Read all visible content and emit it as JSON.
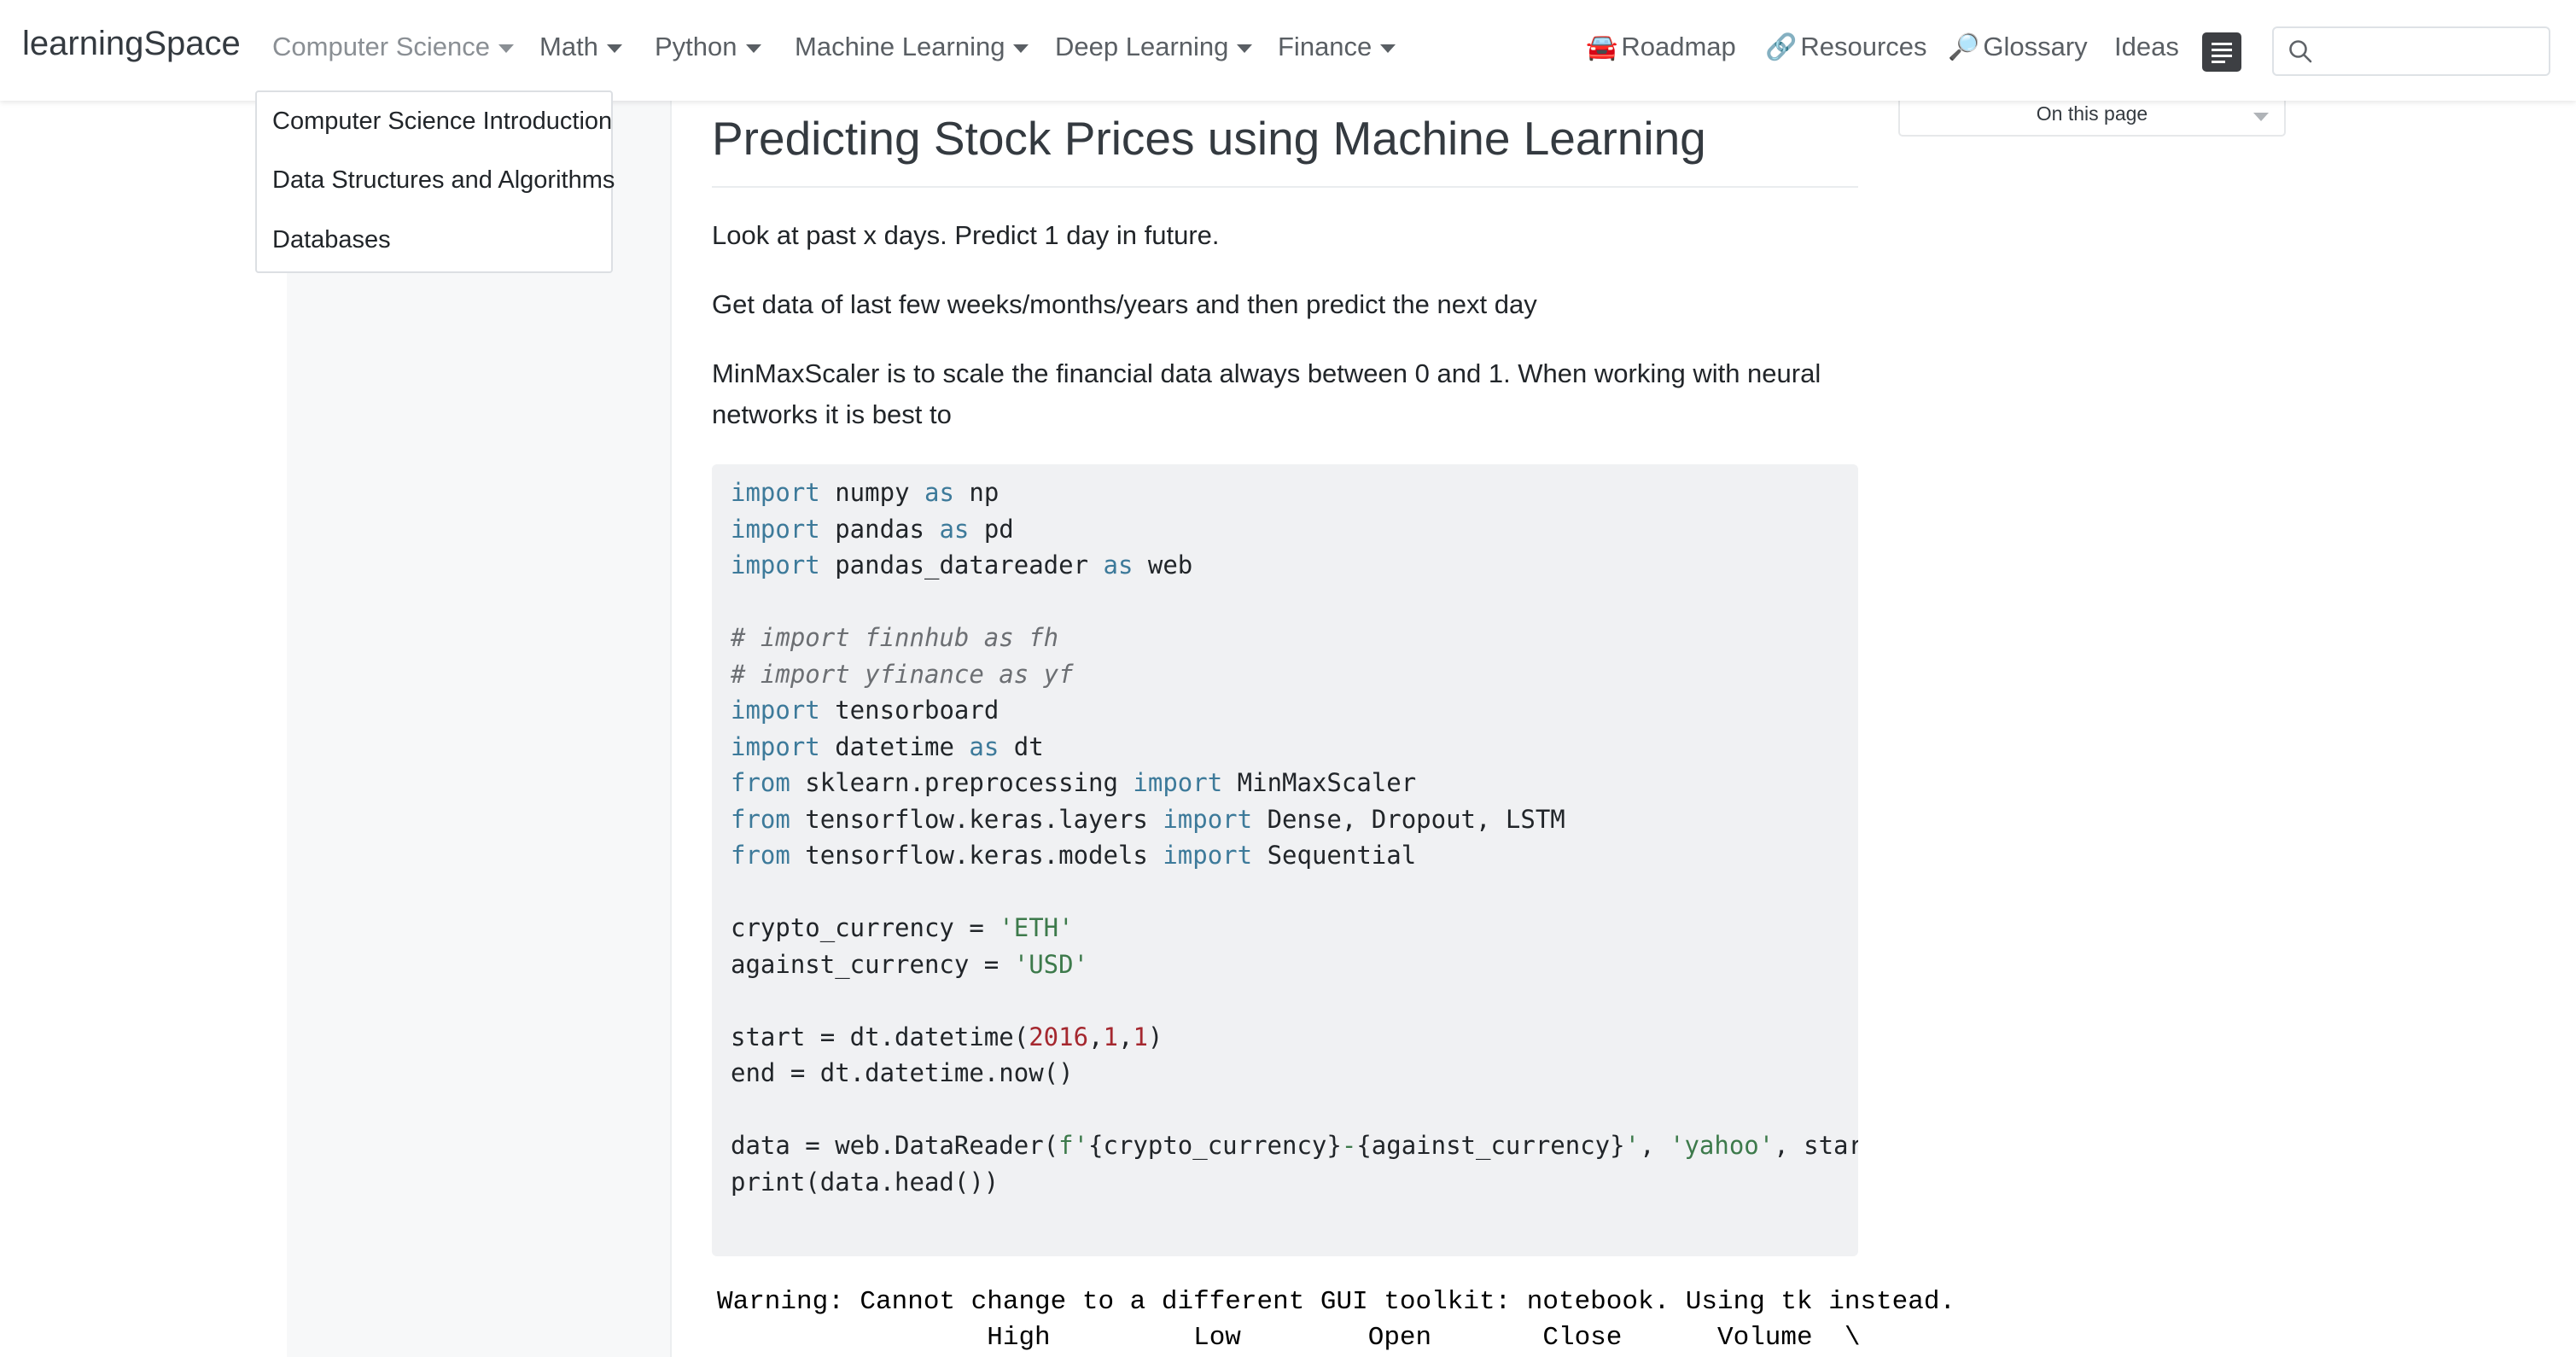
{
  "navbar": {
    "brand": "learningSpace",
    "menus": [
      "Computer Science",
      "Math",
      "Python",
      "Machine Learning",
      "Deep Learning",
      "Finance"
    ],
    "links": [
      {
        "icon": "🚘",
        "label": "Roadmap"
      },
      {
        "icon": "🔗",
        "label": "Resources"
      },
      {
        "icon": "🔎",
        "label": "Glossary"
      },
      {
        "icon": "",
        "label": "Ideas"
      }
    ],
    "search_placeholder": ""
  },
  "dropdown": {
    "items": [
      "Computer Science Introduction",
      "Data Structures and Algorithms",
      "Databases"
    ]
  },
  "toc": {
    "label": "On this page"
  },
  "article": {
    "title": "Predicting Stock Prices using Machine Learning",
    "paragraphs": [
      "Look at past x days. Predict 1 day in future.",
      "Get data of last few weeks/months/years and then predict the next day",
      "MinMaxScaler is to scale the financial data always between 0 and 1. When working with neural networks it is best to"
    ],
    "code_lines": [
      [
        {
          "t": "import",
          "c": "kw"
        },
        {
          "t": " numpy ",
          "c": ""
        },
        {
          "t": "as",
          "c": "kw"
        },
        {
          "t": " np",
          "c": ""
        }
      ],
      [
        {
          "t": "import",
          "c": "kw"
        },
        {
          "t": " pandas ",
          "c": ""
        },
        {
          "t": "as",
          "c": "kw"
        },
        {
          "t": " pd",
          "c": ""
        }
      ],
      [
        {
          "t": "import",
          "c": "kw"
        },
        {
          "t": " pandas_datareader ",
          "c": ""
        },
        {
          "t": "as",
          "c": "kw"
        },
        {
          "t": " web",
          "c": ""
        }
      ],
      [],
      [
        {
          "t": "# import finnhub as fh",
          "c": "cm"
        }
      ],
      [
        {
          "t": "# import yfinance as yf",
          "c": "cm"
        }
      ],
      [
        {
          "t": "import",
          "c": "kw"
        },
        {
          "t": " tensorboard",
          "c": ""
        }
      ],
      [
        {
          "t": "import",
          "c": "kw"
        },
        {
          "t": " datetime ",
          "c": ""
        },
        {
          "t": "as",
          "c": "kw"
        },
        {
          "t": " dt",
          "c": ""
        }
      ],
      [
        {
          "t": "from",
          "c": "kw"
        },
        {
          "t": " sklearn.preprocessing ",
          "c": ""
        },
        {
          "t": "import",
          "c": "kw"
        },
        {
          "t": " MinMaxScaler",
          "c": ""
        }
      ],
      [
        {
          "t": "from",
          "c": "kw"
        },
        {
          "t": " tensorflow.keras.layers ",
          "c": ""
        },
        {
          "t": "import",
          "c": "kw"
        },
        {
          "t": " Dense, Dropout, LSTM",
          "c": ""
        }
      ],
      [
        {
          "t": "from",
          "c": "kw"
        },
        {
          "t": " tensorflow.keras.models ",
          "c": ""
        },
        {
          "t": "import",
          "c": "kw"
        },
        {
          "t": " Sequential",
          "c": ""
        }
      ],
      [],
      [
        {
          "t": "crypto_currency = ",
          "c": ""
        },
        {
          "t": "'ETH'",
          "c": "st"
        }
      ],
      [
        {
          "t": "against_currency = ",
          "c": ""
        },
        {
          "t": "'USD'",
          "c": "st"
        }
      ],
      [],
      [
        {
          "t": "start = dt.datetime(",
          "c": ""
        },
        {
          "t": "2016",
          "c": "nm"
        },
        {
          "t": ",",
          "c": ""
        },
        {
          "t": "1",
          "c": "nm"
        },
        {
          "t": ",",
          "c": ""
        },
        {
          "t": "1",
          "c": "nm"
        },
        {
          "t": ")",
          "c": ""
        }
      ],
      [
        {
          "t": "end = dt.datetime.now()",
          "c": ""
        }
      ],
      [],
      [
        {
          "t": "data = web.DataReader(",
          "c": ""
        },
        {
          "t": "f'",
          "c": "st"
        },
        {
          "t": "{crypto_currency}",
          "c": ""
        },
        {
          "t": "-",
          "c": "st"
        },
        {
          "t": "{against_currency}",
          "c": ""
        },
        {
          "t": "'",
          "c": "st"
        },
        {
          "t": ", ",
          "c": ""
        },
        {
          "t": "'yahoo'",
          "c": "st"
        },
        {
          "t": ", start, end)",
          "c": ""
        }
      ],
      [
        {
          "t": "print(data.head())",
          "c": ""
        }
      ]
    ],
    "output_lines": [
      "Warning: Cannot change to a different GUI toolkit: notebook. Using tk instead.",
      "                 High         Low        Open       Close      Volume  \\"
    ]
  }
}
